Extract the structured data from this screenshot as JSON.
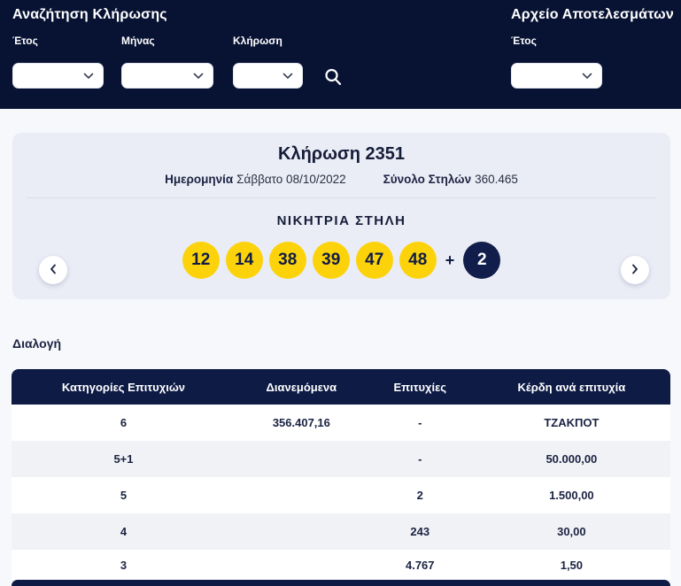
{
  "search": {
    "title": "Αναζήτηση Κλήρωσης",
    "year_label": "Έτος",
    "month_label": "Μήνας",
    "draw_label": "Κλήρωση"
  },
  "archive": {
    "title": "Αρχείο Αποτελεσμάτων",
    "year_label": "Έτος"
  },
  "draw": {
    "title": "Κλήρωση 2351",
    "date_label": "Ημερομηνία",
    "date_value": "Σάββατο 08/10/2022",
    "columns_label": "Σύνολο Στηλών",
    "columns_value": "360.465",
    "winning_title": "ΝΙΚΗΤΡΙΑ ΣΤΗΛΗ",
    "numbers": [
      "12",
      "14",
      "38",
      "39",
      "47",
      "48"
    ],
    "plus": "+",
    "joker": "2"
  },
  "table": {
    "section_label": "Διαλογή",
    "headers": [
      "Κατηγορίες Επιτυχιών",
      "Διανεμόμενα",
      "Επιτυχίες",
      "Κέρδη ανά επιτυχία"
    ],
    "rows": [
      [
        "6",
        "356.407,16",
        "-",
        "ΤΖΑΚΠΟΤ"
      ],
      [
        "5+1",
        "",
        "-",
        "50.000,00"
      ],
      [
        "5",
        "",
        "2",
        "1.500,00"
      ],
      [
        "4",
        "",
        "243",
        "30,00"
      ],
      [
        "3",
        "",
        "4.767",
        "1,50"
      ]
    ]
  },
  "icons": {
    "search": "search-icon",
    "chevron_down": "chevron-down-icon",
    "chevron_left": "chevron-left-icon",
    "chevron_right": "chevron-right-icon"
  },
  "colors": {
    "topbar_navy": "#081334",
    "table_header_navy": "#0e1b45",
    "ball_yellow": "#fcd30a",
    "joker_navy": "#111e4b",
    "card_background": "#eaedf6",
    "row_alt": "#f1f2f6"
  }
}
